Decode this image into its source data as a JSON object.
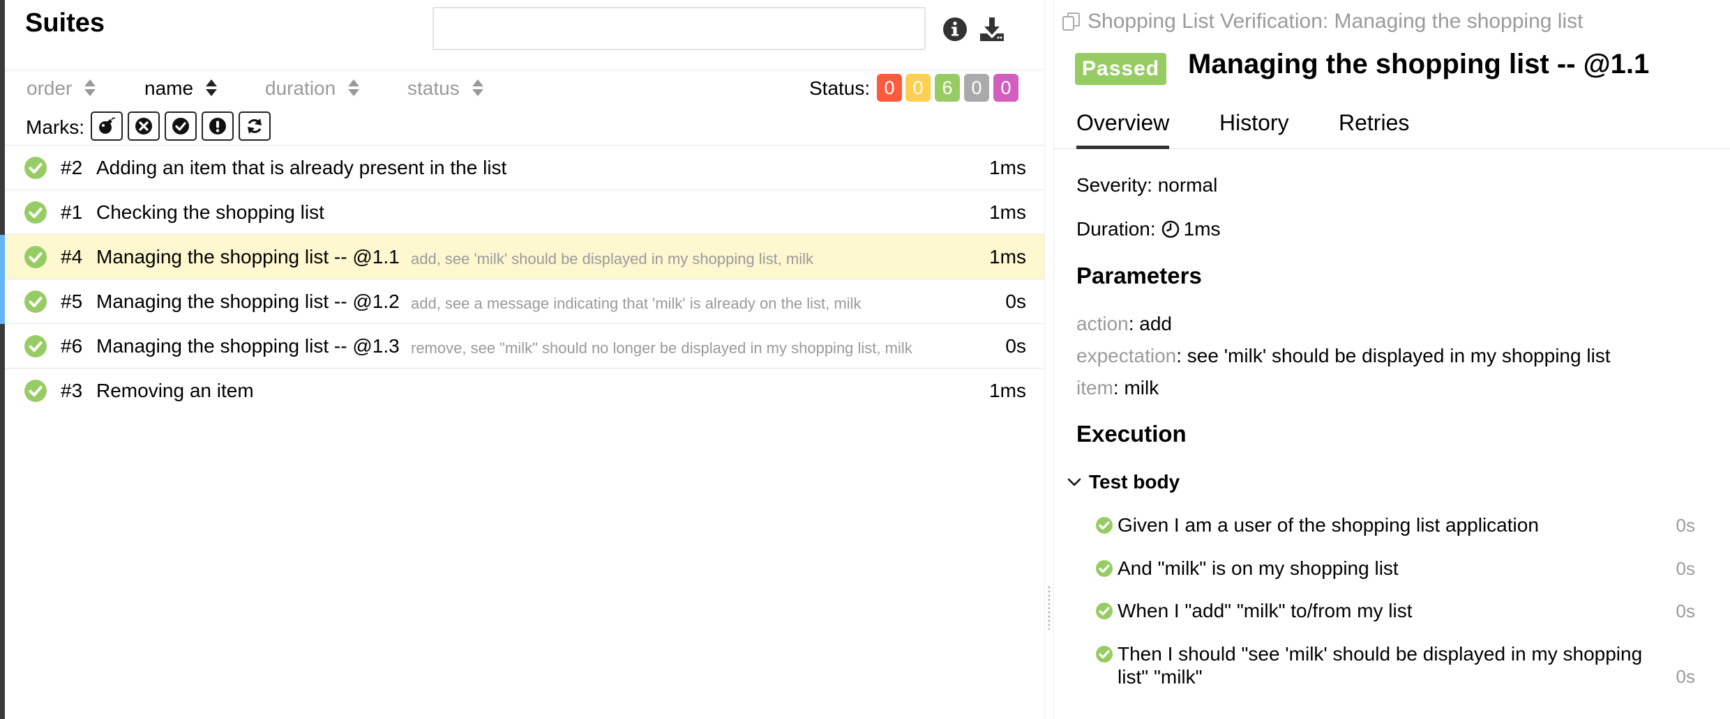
{
  "left": {
    "title": "Suites",
    "search": {
      "value": "",
      "placeholder": ""
    },
    "sort": [
      {
        "label": "order"
      },
      {
        "label": "name"
      },
      {
        "label": "duration"
      },
      {
        "label": "status"
      }
    ],
    "status": {
      "label": "Status:",
      "counts": [
        {
          "value": "0",
          "color": "#fd5a3e"
        },
        {
          "value": "0",
          "color": "#ffd050"
        },
        {
          "value": "6",
          "color": "#97cc64"
        },
        {
          "value": "0",
          "color": "#aaaaaa"
        },
        {
          "value": "0",
          "color": "#d35ebe"
        }
      ]
    },
    "marks": {
      "label": "Marks:",
      "icons": [
        "bomb-icon",
        "times-circle-icon",
        "check-circle-icon",
        "exclamation-circle-icon",
        "refresh-icon"
      ]
    },
    "rows": [
      {
        "num": "#2",
        "name": "Adding an item that is already present in the list",
        "params": "",
        "duration": "1ms"
      },
      {
        "num": "#1",
        "name": "Checking the shopping list",
        "params": "",
        "duration": "1ms"
      },
      {
        "num": "#4",
        "name": "Managing the shopping list -- @1.1",
        "params": "add, see 'milk' should be displayed in my shopping list, milk",
        "duration": "1ms"
      },
      {
        "num": "#5",
        "name": "Managing the shopping list -- @1.2",
        "params": "add, see a message indicating that 'milk' is already on the list, milk",
        "duration": "0s"
      },
      {
        "num": "#6",
        "name": "Managing the shopping list -- @1.3",
        "params": "remove, see \"milk\" should no longer be displayed in my shopping list, milk",
        "duration": "0s"
      },
      {
        "num": "#3",
        "name": "Removing an item",
        "params": "",
        "duration": "1ms"
      }
    ]
  },
  "right": {
    "breadcrumb": "Shopping List Verification: Managing the shopping list",
    "status_badge": "Passed",
    "title": "Managing the shopping list -- @1.1",
    "tabs": [
      {
        "label": "Overview"
      },
      {
        "label": "History"
      },
      {
        "label": "Retries"
      }
    ],
    "severity": "Severity: normal",
    "duration_label": "Duration:",
    "duration_value": "1ms",
    "parameters_title": "Parameters",
    "parameters": [
      {
        "key": "action",
        "value": ": add"
      },
      {
        "key": "expectation",
        "value": ": see 'milk' should be displayed in my shopping list"
      },
      {
        "key": "item",
        "value": ": milk"
      }
    ],
    "execution_title": "Execution",
    "test_body_label": "Test body",
    "steps": [
      {
        "text": "Given I am a user of the shopping list application",
        "duration": "0s"
      },
      {
        "text": "And \"milk\" is on my shopping list",
        "duration": "0s"
      },
      {
        "text": "When I \"add\" \"milk\" to/from my list",
        "duration": "0s"
      },
      {
        "text": "Then I should \"see 'milk' should be displayed in my shopping list\" \"milk\"",
        "duration": "0s"
      }
    ]
  },
  "colors": {
    "passed": "#97cc64",
    "selected_row": "#fdf8d0",
    "row_marker": "#64b5f6"
  }
}
